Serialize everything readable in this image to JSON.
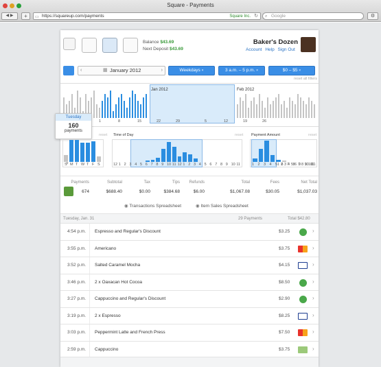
{
  "window": {
    "title": "Square - Payments",
    "url": "https://squareup.com/payments",
    "site_badge": "Square Inc.",
    "search_placeholder": "Google"
  },
  "header": {
    "balance_label": "Balance",
    "balance_value": "$43.69",
    "next_deposit_label": "Next Deposit",
    "next_deposit_value": "$43.69",
    "merchant": "Baker's Dozen",
    "links": [
      "Account",
      "Help",
      "Sign Out"
    ]
  },
  "filters": {
    "month": "January 2012",
    "days": "Weekdays",
    "time": "3 a.m. – 5 p.m.",
    "amount": "$0 – $5",
    "reset_all": "reset all filters"
  },
  "timeline": {
    "labels": [
      "Jan 2012",
      "Feb 2012"
    ],
    "ticks": [
      "1",
      "8",
      "15",
      "22",
      "29",
      "5",
      "12",
      "19",
      "26"
    ],
    "jan_values": [
      6,
      4,
      5,
      7,
      3,
      8,
      6,
      2,
      7,
      5,
      6,
      8,
      4,
      3,
      5,
      7,
      6,
      8,
      2,
      4,
      6,
      7,
      5,
      3,
      6,
      8,
      7,
      5,
      4,
      6,
      7
    ],
    "jan_selected_range": [
      15,
      31
    ],
    "feb_values": [
      4,
      6,
      5,
      7,
      3,
      5,
      6,
      4,
      7,
      5,
      3,
      6,
      4,
      5,
      6,
      7,
      4,
      5,
      3,
      6,
      5,
      4,
      7,
      6,
      5,
      4,
      6,
      5,
      4
    ],
    "selected_day_label": "Tuesday",
    "selected_day_count": "160",
    "selected_day_unit": "payments"
  },
  "charts": {
    "day": {
      "title": "Day of Week",
      "labels": [
        "S",
        "M",
        "T",
        "W",
        "T",
        "F",
        "S"
      ],
      "values": [
        5,
        16,
        16,
        14,
        14,
        15,
        4
      ],
      "reset": "reset"
    },
    "time": {
      "title": "Time of Day",
      "labels": [
        "12",
        "1",
        "2",
        "3",
        "4",
        "5",
        "6",
        "7",
        "8",
        "9",
        "10",
        "11",
        "12",
        "1",
        "2",
        "3",
        "4",
        "5",
        "6",
        "7",
        "8",
        "9",
        "10",
        "11"
      ],
      "values": [
        0,
        0,
        0,
        0,
        0,
        0,
        1,
        2,
        4,
        12,
        18,
        14,
        5,
        9,
        7,
        3,
        0,
        0,
        0,
        0,
        0,
        0,
        0,
        0
      ],
      "reset": "reset"
    },
    "amount": {
      "title": "Payment Amount",
      "labels": [
        "1",
        "2",
        "3",
        "4",
        "5",
        "6",
        "7",
        "8",
        "9",
        "10",
        "11"
      ],
      "values": [
        3,
        11,
        18,
        6,
        2,
        1,
        0,
        0,
        0,
        0,
        0
      ],
      "reset": "reset"
    },
    "right_ticks": [
      "1",
      "2",
      "3",
      "4",
      "5",
      "6",
      "7",
      "8",
      "9",
      "10",
      "11"
    ]
  },
  "summary": {
    "headers": [
      "Payments",
      "Subtotal",
      "Tax",
      "Tips",
      "Refunds",
      "Total",
      "Fees",
      "Net Total"
    ],
    "values": [
      "674",
      "$688.40",
      "$0.00",
      "$384.68",
      "$6.00",
      "$1,067.08",
      "$30.05",
      "$1,037.03"
    ],
    "export_transactions": "Transactions Spreadsheet",
    "export_items": "Item Sales Spreadsheet"
  },
  "list": {
    "date": "Tuesday, Jan. 31",
    "payments": "29 Payments",
    "total": "Total $42.80",
    "rows": [
      {
        "time": "4:54 p.m.",
        "name": "Espresso and Regular's Discount",
        "amount": "$3.25",
        "method": "cash"
      },
      {
        "time": "3:55 p.m.",
        "name": "Americano",
        "amount": "$3.75",
        "method": "mastercard"
      },
      {
        "time": "3:52 p.m.",
        "name": "Salted Caramel Mocha",
        "amount": "$4.15",
        "method": "visa"
      },
      {
        "time": "3:46 p.m.",
        "name": "2 x Oaxacan Hot Cocoa",
        "amount": "$8.50",
        "method": "cash"
      },
      {
        "time": "3:27 p.m.",
        "name": "Cappuccino and Regular's Discount",
        "amount": "$2.90",
        "method": "cash"
      },
      {
        "time": "3:19 p.m.",
        "name": "2 x Espresso",
        "amount": "$8.25",
        "method": "visa"
      },
      {
        "time": "3:03 p.m.",
        "name": "Peppermint Latte and French Press",
        "amount": "$7.50",
        "method": "mastercard"
      },
      {
        "time": "2:59 p.m.",
        "name": "Cappuccino",
        "amount": "$3.75",
        "method": "cash-bill"
      }
    ]
  },
  "colors": {
    "accent": "#3a8ee6",
    "green": "#3a9a3a",
    "bar_gray": "#c4c4c4",
    "bar_blue": "#2a8de0"
  }
}
